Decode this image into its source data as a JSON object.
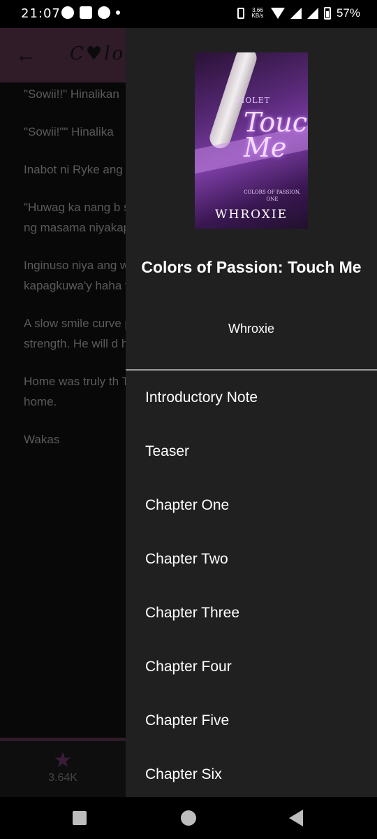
{
  "status_bar": {
    "time": "21:07",
    "speed": "3.66 KB/s",
    "battery": "57%",
    "left_icons": [
      "facebook-icon",
      "mail-icon",
      "speedometer-icon",
      "dot-icon"
    ],
    "right_icons": [
      "vibrate-icon",
      "wifi-icon",
      "signal-icon",
      "signal-icon",
      "battery-icon"
    ]
  },
  "reader": {
    "title": "C♥lors",
    "paragraphs": [
      "\"Sowii!!\" Hinalikan",
      "\"Sowii!\"\" Hinalika",
      "Inabot ni Ryke ang pagitan ng hita niy",
      "\"Huwag ka nang b sa anak natin ay m nagmana, eh.\" Tur Violet ng masama niyakap mula sa lil",
      "Inginuso niya ang walang nangyari. S dalawang kapatid. kapagkuwa'y haha talaga ito. Manana",
      "A slow smile curve playing. Being with great happiness. H strength. He will d he will take care o for blessing him w",
      "Home was truly th There could be no incredible happine his home.",
      "Wakas"
    ],
    "votes": "3.64K"
  },
  "drawer": {
    "cover": {
      "series_word": "VIOLET",
      "title_art": "Touch Me",
      "series": "COLORS OF PASSION, ONE",
      "author": "WHROXIE"
    },
    "book_title": "Colors of Passion: Touch Me",
    "author": "Whroxie",
    "toc": [
      "Introductory Note",
      "Teaser",
      "Chapter One",
      "Chapter Two",
      "Chapter Three",
      "Chapter Four",
      "Chapter Five",
      "Chapter Six"
    ]
  },
  "colors": {
    "header": "#4a2a40",
    "drawer_bg": "#202020",
    "accent": "#5b2d55"
  }
}
